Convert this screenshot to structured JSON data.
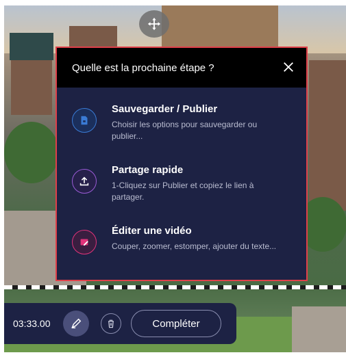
{
  "dialog": {
    "title": "Quelle est la prochaine étape ?",
    "options": [
      {
        "title": "Sauvegarder / Publier",
        "description": "Choisir les options pour sauvegarder ou publier...",
        "icon": "save-publish-icon",
        "accent": "#3a7bd5"
      },
      {
        "title": "Partage rapide",
        "description": "1-Cliquez sur Publier et copiez le lien à partager.",
        "icon": "upload-share-icon",
        "accent": "#9a5bd6"
      },
      {
        "title": "Éditer une vidéo",
        "description": "Couper, zoomer, estomper, ajouter du texte...",
        "icon": "video-edit-icon",
        "accent": "#e0337a"
      }
    ],
    "border_color": "#e0404a"
  },
  "toolbar": {
    "timer": "03:33.00",
    "complete_label": "Compléter"
  },
  "colors": {
    "panel": "#1d2244",
    "header": "#000000"
  }
}
